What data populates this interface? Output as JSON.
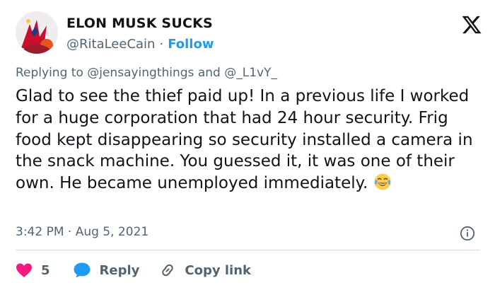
{
  "tweet": {
    "author_name": "ELON MUSK SUCKS",
    "handle": "@RitaLeeCain",
    "separator": "·",
    "follow_label": "Follow",
    "replying_prefix": "Replying to",
    "replying_user1": "@jensayingthings",
    "replying_and": "and",
    "replying_user2": "@_L1vY_",
    "text": "Glad to see the thief paid up! In a previous life I worked for a huge corporation that had 24 hour security. Frig food kept disappearing so security installed a camera in the snack machine. You guessed it, it was one of their own. He became unemployed immediately.",
    "timestamp": "3:42 PM · Aug 5, 2021"
  },
  "actions": {
    "like_count": "5",
    "reply_label": "Reply",
    "copy_label": "Copy link"
  },
  "icons": {
    "brand": "x-logo-icon",
    "info": "info-icon",
    "like": "heart-icon",
    "reply": "speech-bubble-icon",
    "copy": "link-icon"
  },
  "colors": {
    "accent": "#1d9bf0",
    "like": "#f91880",
    "text": "#0f1419",
    "muted": "#536471"
  }
}
